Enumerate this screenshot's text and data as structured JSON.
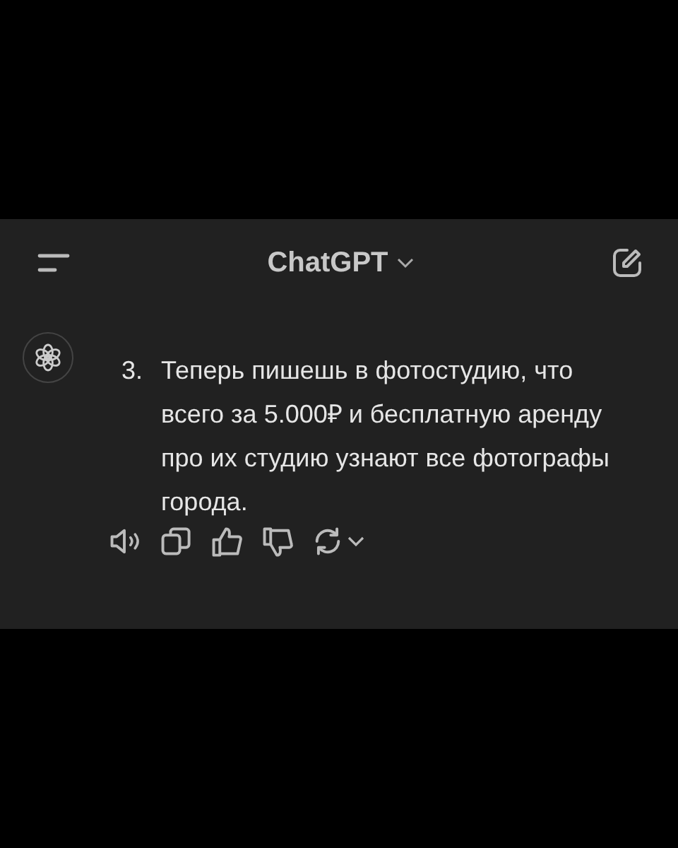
{
  "header": {
    "title": "ChatGPT"
  },
  "message": {
    "number": "3.",
    "text": "Теперь пишешь в фотостудию, что всего за 5.000₽ и бесплатную аренду про их студию узнают все фотографы города."
  },
  "actions": [
    {
      "kind": "read-aloud"
    },
    {
      "kind": "copy"
    },
    {
      "kind": "like"
    },
    {
      "kind": "dislike"
    },
    {
      "kind": "regenerate"
    }
  ]
}
